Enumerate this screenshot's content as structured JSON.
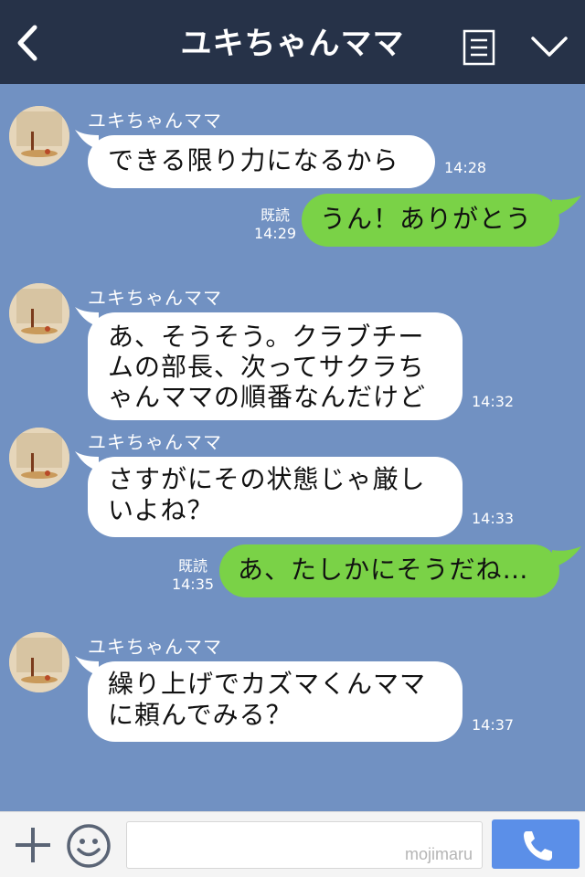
{
  "header": {
    "title": "ユキちゃんママ",
    "back_icon": "chevron-left-icon",
    "menu_icon": "list-icon",
    "collapse_icon": "chevron-down-icon",
    "bg_color": "#263248"
  },
  "chat": {
    "bg_color": "#7191c2",
    "messages": [
      {
        "sender": "ユキちゃんママ",
        "text": "できる限り力になるから",
        "time": "14:28"
      },
      {
        "read": "既読",
        "text": "うん！ありがとう",
        "time": "14:29"
      },
      {
        "sender": "ユキちゃんママ",
        "lines": [
          "あ、そうそう。クラブチー",
          "ムの部長、次ってサクラち",
          "ゃんママの順番なんだけど"
        ],
        "time": "14:32"
      },
      {
        "sender": "ユキちゃんママ",
        "lines": [
          "さすがにその状態じゃ厳し",
          "いよね？"
        ],
        "time": "14:33"
      },
      {
        "read": "既読",
        "text": "あ、たしかにそうだね…",
        "time": "14:35"
      },
      {
        "sender": "ユキちゃんママ",
        "lines": [
          "繰り上げでカズマくんママ",
          "に頼んでみる？"
        ],
        "time": "14:37"
      }
    ],
    "incoming_color": "#ffffff",
    "outgoing_color": "#7ad247"
  },
  "footer": {
    "add_icon": "plus-icon",
    "emoji_icon": "smile-icon",
    "input_value": "",
    "watermark": "mojimaru",
    "call_icon": "phone-icon",
    "call_color": "#5b8fe8"
  }
}
